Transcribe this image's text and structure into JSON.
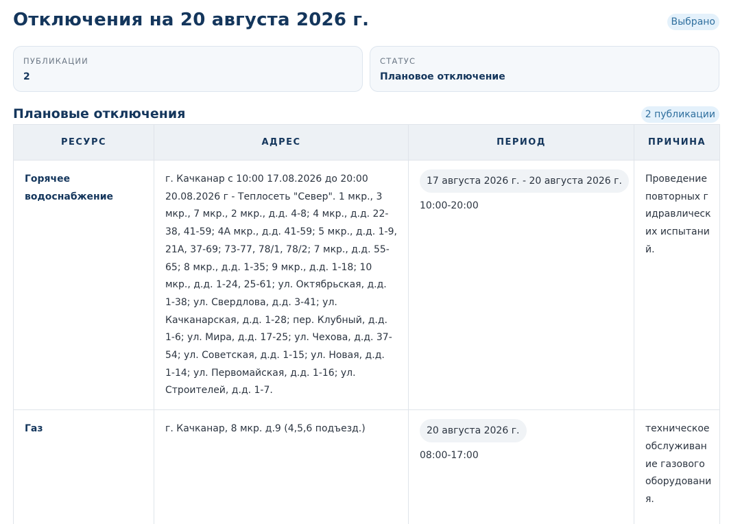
{
  "header": {
    "title": "Отключения на 20 августа 2026 г.",
    "selected_label": "Выбрано"
  },
  "stats": {
    "publications": {
      "label": "ПУБЛИКАЦИИ",
      "value": "2"
    },
    "status": {
      "label": "СТАТУС",
      "value": "Плановое отключение"
    }
  },
  "section": {
    "title": "Плановые отключения",
    "count_label": "2 публикации"
  },
  "table": {
    "columns": [
      "РЕСУРС",
      "АДРЕС",
      "ПЕРИОД",
      "ПРИЧИНА"
    ],
    "rows": [
      {
        "resource": "Горячее водоснабжение",
        "address": "г. Качканар с 10:00 17.08.2026 до 20:00 20.08.2026 г - Теплосеть \"Север\". 1 мкр., 3 мкр., 7 мкр., 2 мкр., д.д. 4-8; 4 мкр., д.д. 22-38, 41-59; 4А мкр., д.д. 41-59; 5 мкр., д.д. 1-9, 21А, 37-69; 73-77, 78/1, 78/2; 7 мкр., д.д. 55-65; 8 мкр., д.д. 1-35; 9 мкр., д.д. 1-18; 10 мкр., д.д. 1-24, 25-61; ул. Октябрьская, д.д. 1-38; ул. Свердлова, д.д. 3-41; ул. Качканарская, д.д. 1-28; пер. Клубный, д.д. 1-6; ул. Мира, д.д. 17-25; ул. Чехова, д.д. 37-54; ул. Советская, д.д. 1-15; ул. Новая, д.д. 1-14; ул. Первомайская, д.д. 1-16; ул. Строителей, д.д. 1-7.",
        "period_dates": "17 августа 2026 г. - 20 августа 2026 г.",
        "period_time": "10:00-20:00",
        "reason": "Проведение повторных гидравлических испытаний."
      },
      {
        "resource": "Газ",
        "address": "г. Качканар, 8 мкр. д.9 (4,5,6 подъезд.)",
        "period_dates": "20 августа 2026 г.",
        "period_time": "08:00-17:00",
        "reason": "техническое обслуживание газового оборудования."
      }
    ]
  },
  "colors": {
    "heading": "#14365c",
    "chip_bg": "#e4f1fb",
    "chip_text": "#2f6f9e",
    "card_bg": "#f5f8fb",
    "table_header_bg": "#edf1f5",
    "border": "#dfe4ea"
  }
}
